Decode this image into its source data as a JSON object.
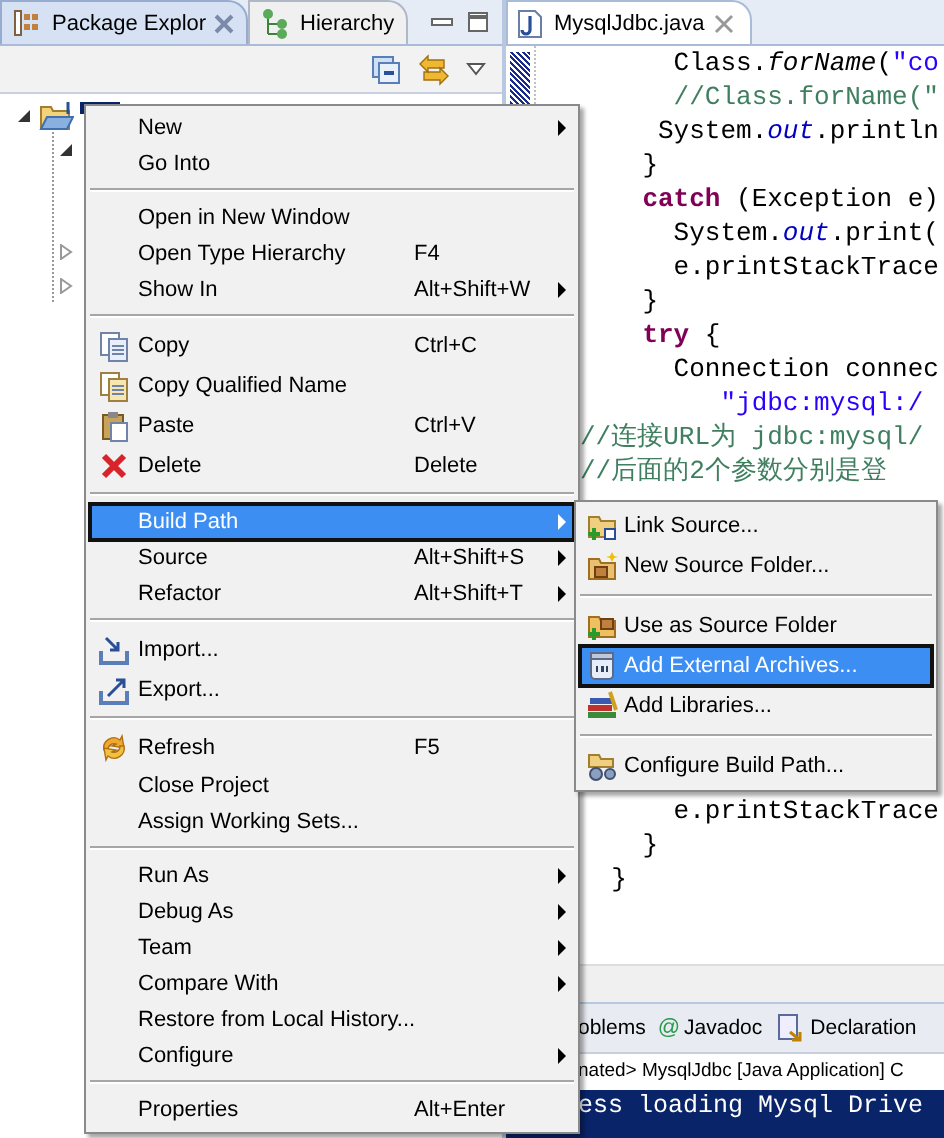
{
  "left_panel": {
    "tabs": [
      {
        "label": "Package Explor",
        "kind": "package",
        "selected": true,
        "closable": true
      },
      {
        "label": "Hierarchy",
        "kind": "hierarchy",
        "selected": false,
        "closable": false
      }
    ],
    "tree": {
      "expanded": true,
      "selected": true,
      "children": [
        {
          "expanded": true
        },
        {
          "expanded": false
        },
        {
          "expanded": false
        }
      ]
    }
  },
  "editor": {
    "tab": {
      "label": "MysqlJdbc.java",
      "selected": true
    },
    "code_top": [
      [
        {
          "text": "      Class.",
          "kind": "plain"
        },
        {
          "text": "forName",
          "kind": "static_method"
        },
        {
          "text": "(",
          "kind": "plain"
        },
        {
          "text": "\"co",
          "kind": "string"
        }
      ],
      [
        {
          "text": "      //Class.forName(\"",
          "kind": "comment"
        }
      ],
      [
        {
          "text": "     System.",
          "kind": "plain"
        },
        {
          "text": "out",
          "kind": "field"
        },
        {
          "text": ".println",
          "kind": "plain"
        }
      ],
      [
        {
          "text": "    }",
          "kind": "plain"
        }
      ],
      [
        {
          "text": "    catch",
          "kind": "keyword"
        },
        {
          "text": " (Exception e)",
          "kind": "plain"
        }
      ],
      [
        {
          "text": "      System.",
          "kind": "plain"
        },
        {
          "text": "out",
          "kind": "field"
        },
        {
          "text": ".print(",
          "kind": "plain"
        }
      ],
      [
        {
          "text": "      e.printStackTrace",
          "kind": "plain"
        }
      ],
      [
        {
          "text": "    }",
          "kind": "plain"
        }
      ],
      [
        {
          "text": "    try",
          "kind": "keyword"
        },
        {
          "text": " {",
          "kind": "plain"
        }
      ],
      [
        {
          "text": "      Connection connec",
          "kind": "plain"
        }
      ],
      [
        {
          "text": "         \"jdbc:mysql:/",
          "kind": "string"
        }
      ],
      [
        {
          "text": "//连接URL为 jdbc:mysql/",
          "kind": "comment"
        }
      ],
      [
        {
          "text": "//后面的2个参数分别是登",
          "kind": "comment"
        }
      ]
    ],
    "code_bottom": [
      [
        {
          "text": "      e.printStackTrace",
          "kind": "plain"
        }
      ],
      [
        {
          "text": "    }",
          "kind": "plain"
        }
      ],
      [
        {
          "text": "  }",
          "kind": "plain"
        }
      ]
    ]
  },
  "context_menu": {
    "items": [
      {
        "kind": "plain",
        "label": "New",
        "submenu": true,
        "selected": false
      },
      {
        "kind": "plain",
        "label": "Go Into",
        "selected": false
      },
      {
        "kind": "separator"
      },
      {
        "kind": "plain",
        "label": "Open in New Window",
        "selected": false
      },
      {
        "kind": "plain",
        "label": "Open Type Hierarchy",
        "shortcut": "F4",
        "selected": false
      },
      {
        "kind": "plain",
        "label": "Show In",
        "shortcut": "Alt+Shift+W",
        "submenu": true,
        "selected": false
      },
      {
        "kind": "separator"
      },
      {
        "kind": "copy",
        "label": "Copy",
        "shortcut": "Ctrl+C",
        "selected": false
      },
      {
        "kind": "copy_name",
        "label": "Copy Qualified Name",
        "selected": false
      },
      {
        "kind": "paste",
        "label": "Paste",
        "shortcut": "Ctrl+V",
        "selected": false
      },
      {
        "kind": "delete",
        "label": "Delete",
        "shortcut": "Delete",
        "selected": false
      },
      {
        "kind": "separator"
      },
      {
        "kind": "plain",
        "label": "Build Path",
        "submenu": true,
        "selected": true
      },
      {
        "kind": "plain",
        "label": "Source",
        "shortcut": "Alt+Shift+S",
        "submenu": true,
        "selected": false
      },
      {
        "kind": "plain",
        "label": "Refactor",
        "shortcut": "Alt+Shift+T",
        "submenu": true,
        "selected": false
      },
      {
        "kind": "separator"
      },
      {
        "kind": "import",
        "label": "Import...",
        "selected": false
      },
      {
        "kind": "export",
        "label": "Export...",
        "selected": false
      },
      {
        "kind": "separator"
      },
      {
        "kind": "refresh",
        "label": "Refresh",
        "shortcut": "F5",
        "selected": false
      },
      {
        "kind": "plain",
        "label": "Close Project",
        "selected": false
      },
      {
        "kind": "plain",
        "label": "Assign Working Sets...",
        "selected": false
      },
      {
        "kind": "separator"
      },
      {
        "kind": "plain",
        "label": "Run As",
        "submenu": true,
        "selected": false
      },
      {
        "kind": "plain",
        "label": "Debug As",
        "submenu": true,
        "selected": false
      },
      {
        "kind": "plain",
        "label": "Team",
        "submenu": true,
        "selected": false
      },
      {
        "kind": "plain",
        "label": "Compare With",
        "submenu": true,
        "selected": false
      },
      {
        "kind": "plain",
        "label": "Restore from Local History...",
        "selected": false
      },
      {
        "kind": "plain",
        "label": "Configure",
        "submenu": true,
        "selected": false
      },
      {
        "kind": "separator"
      },
      {
        "kind": "plain",
        "label": "Properties",
        "shortcut": "Alt+Enter",
        "selected": false
      }
    ]
  },
  "submenu": {
    "items": [
      {
        "kind": "link_source",
        "label": "Link Source...",
        "selected": false
      },
      {
        "kind": "new_source_folder",
        "label": "New Source Folder...",
        "selected": false
      },
      {
        "kind": "separator"
      },
      {
        "kind": "use_as_source",
        "label": "Use as Source Folder",
        "selected": false
      },
      {
        "kind": "archive",
        "label": "Add External Archives...",
        "selected": true
      },
      {
        "kind": "libraries",
        "label": "Add Libraries...",
        "selected": false
      },
      {
        "kind": "separator"
      },
      {
        "kind": "configure",
        "label": "Configure Build Path...",
        "selected": false
      }
    ]
  },
  "bottom_panel": {
    "tabs": [
      {
        "label": "oblems",
        "kind": "plain",
        "selected": false
      },
      {
        "label": "Javadoc",
        "kind": "javadoc",
        "glyph": "@",
        "selected": false
      },
      {
        "label": "Declaration",
        "kind": "declaration",
        "selected": false
      }
    ],
    "status": "nated> MysqlJdbc [Java Application] C",
    "console": [
      "ess loading Mysql Drive"
    ]
  }
}
